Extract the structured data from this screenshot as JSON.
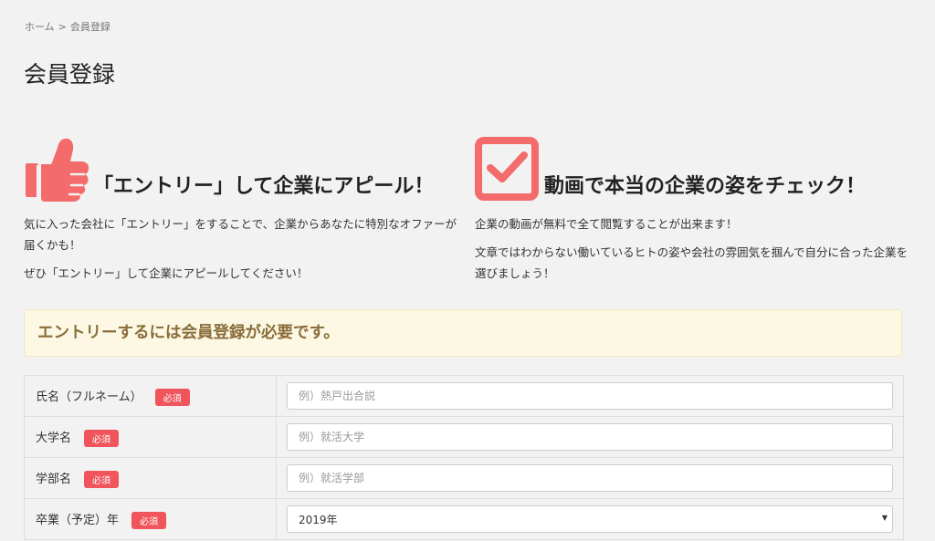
{
  "breadcrumb": {
    "home": "ホーム",
    "separator": ">",
    "current": "会員登録"
  },
  "page_title": "会員登録",
  "features": [
    {
      "icon": "thumbs-up-icon",
      "title": "「エントリー」して企業にアピール！",
      "paragraphs": [
        "気に入った会社に「エントリー」をすることで、企業からあなたに特別なオファーが届くかも！",
        "ぜひ「エントリー」して企業にアピールしてください！"
      ]
    },
    {
      "icon": "checkbox-icon",
      "title": "動画で本当の企業の姿をチェック！",
      "paragraphs": [
        "企業の動画が無料で全て閲覧することが出来ます！",
        "文章ではわからない働いているヒトの姿や会社の雰囲気を掴んで自分に合った企業を選びましょう！"
      ]
    }
  ],
  "notice": "エントリーするには会員登録が必要です。",
  "form": {
    "required_badge": "必須",
    "rows": [
      {
        "label": "氏名（フルネーム）",
        "placeholder": "例）熱戸出合説"
      },
      {
        "label": "大学名",
        "placeholder": "例）就活大学"
      },
      {
        "label": "学部名",
        "placeholder": "例）就活学部"
      },
      {
        "label": "卒業（予定）年",
        "value": "2019年"
      }
    ]
  },
  "colors": {
    "accent": "#f46b6b",
    "badge": "#f0555c",
    "notice_bg": "#fcf8e3",
    "notice_text": "#8a6d3b"
  }
}
